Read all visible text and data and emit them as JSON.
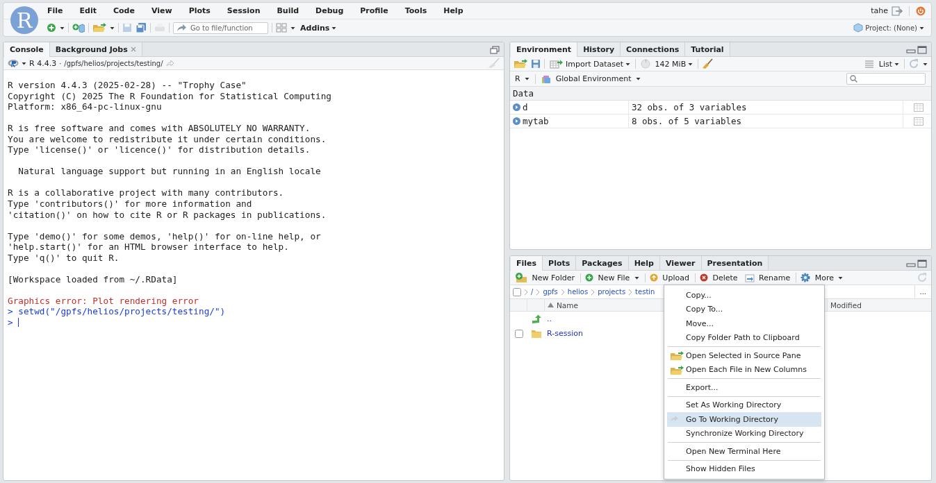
{
  "app": {
    "logo": "R",
    "menu": [
      "File",
      "Edit",
      "Code",
      "View",
      "Plots",
      "Session",
      "Build",
      "Debug",
      "Profile",
      "Tools",
      "Help"
    ],
    "goto_placeholder": "Go to file/function",
    "addins": "Addins",
    "user": "tahe",
    "project": "Project: (None)"
  },
  "console": {
    "tabs": [
      {
        "label": "Console",
        "selected": true,
        "closable": false
      },
      {
        "label": "Background Jobs",
        "selected": false,
        "closable": true
      }
    ],
    "version": "R 4.4.3",
    "separator": "·",
    "path": "/gpfs/helios/projects/testing/",
    "blocks": [
      [
        {
          "kind": "output",
          "text": "R version 4.4.3 (2025-02-28) -- \"Trophy Case\""
        },
        {
          "kind": "output",
          "text": "Copyright (C) 2025 The R Foundation for Statistical Computing"
        },
        {
          "kind": "output",
          "text": "Platform: x86_64-pc-linux-gnu"
        }
      ],
      [
        {
          "kind": "output",
          "text": "R is free software and comes with ABSOLUTELY NO WARRANTY."
        },
        {
          "kind": "output",
          "text": "You are welcome to redistribute it under certain conditions."
        },
        {
          "kind": "output",
          "text": "Type 'license()' or 'licence()' for distribution details."
        }
      ],
      [
        {
          "kind": "output",
          "text": "  Natural language support but running in an English locale"
        }
      ],
      [
        {
          "kind": "output",
          "text": "R is a collaborative project with many contributors."
        },
        {
          "kind": "output",
          "text": "Type 'contributors()' for more information and"
        },
        {
          "kind": "output",
          "text": "'citation()' on how to cite R or R packages in publications."
        }
      ],
      [
        {
          "kind": "output",
          "text": "Type 'demo()' for some demos, 'help()' for on-line help, or"
        },
        {
          "kind": "output",
          "text": "'help.start()' for an HTML browser interface to help."
        },
        {
          "kind": "output",
          "text": "Type 'q()' to quit R."
        }
      ],
      [
        {
          "kind": "output",
          "text": "[Workspace loaded from ~/.RData]"
        }
      ],
      [
        {
          "kind": "error",
          "text": "Graphics error: Plot rendering error"
        },
        {
          "kind": "input",
          "text": "> setwd(\"/gpfs/helios/projects/testing/\")"
        },
        {
          "kind": "prompt",
          "text": ">"
        }
      ]
    ]
  },
  "environment": {
    "tabs": [
      {
        "label": "Environment",
        "selected": true
      },
      {
        "label": "History",
        "selected": false
      },
      {
        "label": "Connections",
        "selected": false
      },
      {
        "label": "Tutorial",
        "selected": false
      }
    ],
    "import": "Import Dataset",
    "memory": "142 MiB",
    "view": "List",
    "language": "R",
    "scope": "Global Environment",
    "section": "Data",
    "rows": [
      {
        "name": "d",
        "value": "32 obs. of 3 variables"
      },
      {
        "name": "mytab",
        "value": "8 obs. of 5 variables"
      }
    ]
  },
  "files": {
    "tabs": [
      {
        "label": "Files",
        "selected": true
      },
      {
        "label": "Plots",
        "selected": false
      },
      {
        "label": "Packages",
        "selected": false
      },
      {
        "label": "Help",
        "selected": false
      },
      {
        "label": "Viewer",
        "selected": false
      },
      {
        "label": "Presentation",
        "selected": false
      }
    ],
    "actions": [
      {
        "kind": "new-folder",
        "label": "New Folder",
        "divider_before": false,
        "dropdown": false
      },
      {
        "kind": "new-file",
        "label": "New File",
        "divider_before": true,
        "dropdown": true
      },
      {
        "kind": "upload",
        "label": "Upload",
        "divider_before": true,
        "dropdown": false
      },
      {
        "kind": "delete",
        "label": "Delete",
        "divider_before": true,
        "dropdown": false
      },
      {
        "kind": "rename",
        "label": "Rename",
        "divider_before": false,
        "dropdown": false
      },
      {
        "kind": "more",
        "label": "More",
        "divider_before": true,
        "dropdown": true
      }
    ],
    "select_all_checked": false,
    "breadcrumb": [
      "/",
      "gpfs",
      "helios",
      "projects",
      "testin"
    ],
    "overflow": "...",
    "columns": [
      {
        "label": "Name",
        "sorted": true
      },
      {
        "label": "Modified",
        "sorted": false
      }
    ],
    "rows": [
      {
        "kind": "parent",
        "name": ".."
      },
      {
        "kind": "folder",
        "name": "R-session",
        "checked": false
      }
    ],
    "menu": [
      {
        "kind": "item",
        "label": "Copy...",
        "selected": false
      },
      {
        "kind": "item",
        "label": "Copy To...",
        "selected": false
      },
      {
        "kind": "item",
        "label": "Move...",
        "selected": false
      },
      {
        "kind": "item",
        "label": "Copy Folder Path to Clipboard",
        "selected": false
      },
      {
        "kind": "separator"
      },
      {
        "kind": "open",
        "label": "Open Selected in Source Pane",
        "selected": false
      },
      {
        "kind": "open",
        "label": "Open Each File in New Columns",
        "selected": false
      },
      {
        "kind": "separator"
      },
      {
        "kind": "item",
        "label": "Export...",
        "selected": false
      },
      {
        "kind": "separator"
      },
      {
        "kind": "item",
        "label": "Set As Working Directory",
        "selected": false
      },
      {
        "kind": "goto",
        "label": "Go To Working Directory",
        "selected": true
      },
      {
        "kind": "item",
        "label": "Synchronize Working Directory",
        "selected": false
      },
      {
        "kind": "separator"
      },
      {
        "kind": "item",
        "label": "Open New Terminal Here",
        "selected": false
      },
      {
        "kind": "separator"
      },
      {
        "kind": "item",
        "label": "Show Hidden Files",
        "selected": false
      }
    ]
  }
}
